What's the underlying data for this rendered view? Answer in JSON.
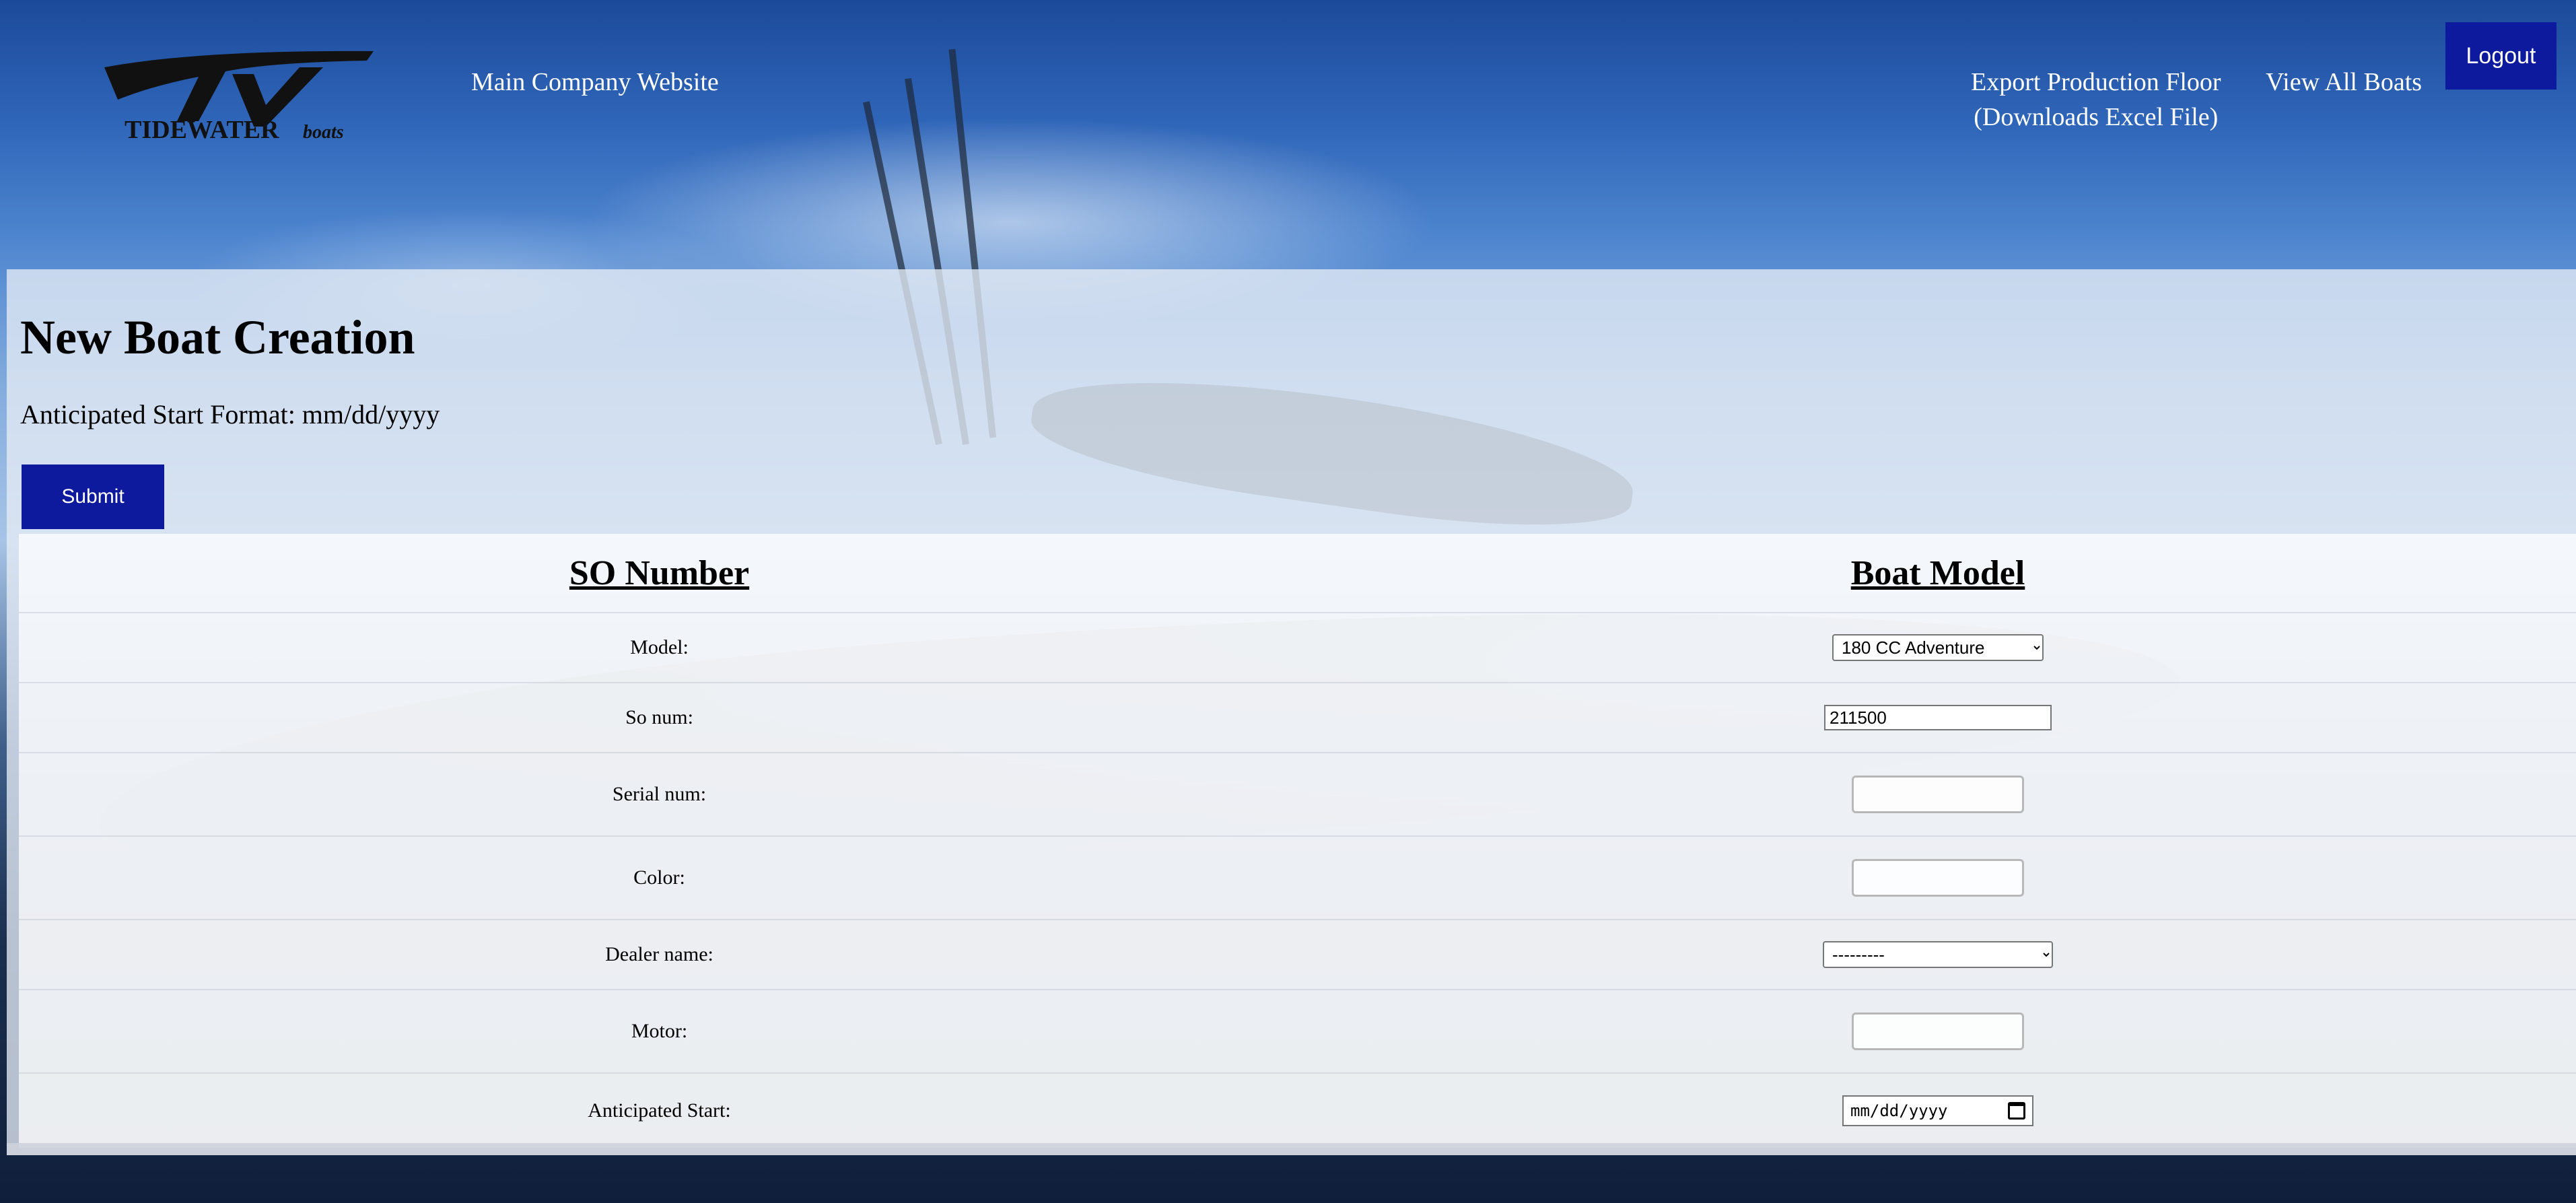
{
  "header": {
    "logo_alt": "TIDEWATER boats",
    "logo_word": "TIDEWATER",
    "logo_sub": "boats",
    "main_site_link": "Main Company Website",
    "export_line1": "Export Production Floor",
    "export_line2": "(Downloads Excel File)",
    "view_all_link": "View All Boats",
    "logout_label": "Logout"
  },
  "page": {
    "title": "New Boat Creation",
    "format_note": "Anticipated Start Format: mm/dd/yyyy",
    "submit_label": "Submit"
  },
  "form": {
    "col_left": "SO Number",
    "col_right": "Boat Model",
    "fields": {
      "model_label": "Model:",
      "model_value": "180 CC Adventure",
      "so_label": "So num:",
      "so_value": "211500",
      "serial_label": "Serial num:",
      "serial_value": "",
      "color_label": "Color:",
      "color_value": "",
      "dealer_label": "Dealer name:",
      "dealer_value": "---------",
      "motor_label": "Motor:",
      "motor_value": "",
      "start_label": "Anticipated Start:",
      "start_placeholder": "mm/dd/yyyy"
    }
  },
  "colors": {
    "button_blue": "#0e1a9e",
    "link_white": "#ffffff"
  },
  "icons": {
    "calendar": "calendar-icon",
    "dropdown": "chevron-down-icon"
  }
}
